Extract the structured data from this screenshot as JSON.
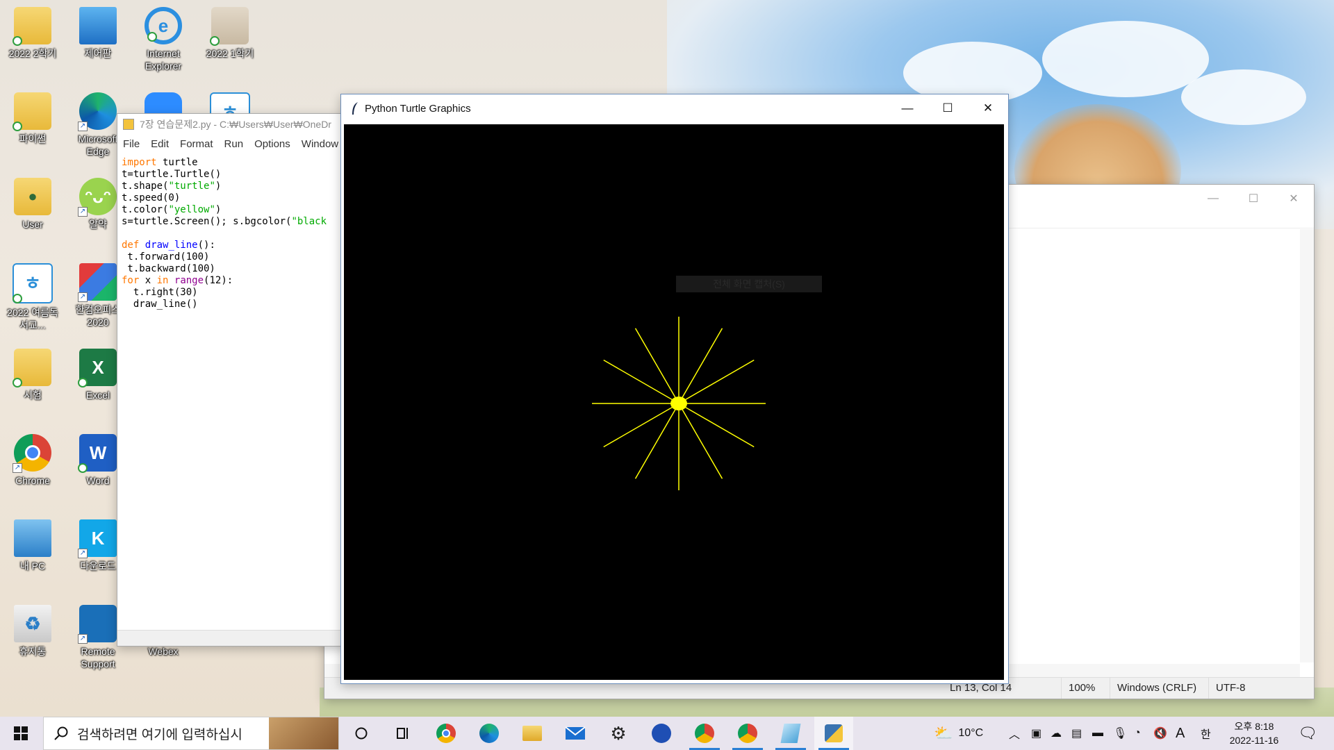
{
  "desktop": {
    "icons": [
      {
        "label": "2022 2학기"
      },
      {
        "label": "제어판"
      },
      {
        "label": "Internet Explorer"
      },
      {
        "label": "2022 1학기"
      },
      {
        "label": "파이썬"
      },
      {
        "label": "Microsoft Edge"
      },
      {
        "label": "User"
      },
      {
        "label": "알약"
      },
      {
        "label": "2022 여름독서교..."
      },
      {
        "label": "한컴오피스 2020"
      },
      {
        "label": "시험"
      },
      {
        "label": "Excel"
      },
      {
        "label": "Chrome"
      },
      {
        "label": "Word"
      },
      {
        "label": "내 PC"
      },
      {
        "label": "다운로드"
      },
      {
        "label": "휴지통"
      },
      {
        "label": "Remote Support"
      },
      {
        "label": "Webex"
      }
    ]
  },
  "idle": {
    "title": "7장 연습문제2.py - C:₩Users₩User₩OneDr",
    "menu": [
      "File",
      "Edit",
      "Format",
      "Run",
      "Options",
      "Window"
    ],
    "code": {
      "l1_kw": "import",
      "l1_rest": " turtle",
      "l2": "t=turtle.Turtle()",
      "l3_a": "t.shape(",
      "l3_s": "\"turtle\"",
      "l3_b": ")",
      "l4": "t.speed(0)",
      "l5_a": "t.color(",
      "l5_s": "\"yellow\"",
      "l5_b": ")",
      "l6_a": "s=turtle.Screen(); s.bgcolor(",
      "l6_s": "\"black",
      "l8_kw": "def",
      "l8_fn": " draw_line",
      "l8_b": "():",
      "l9": " t.forward(100)",
      "l10": " t.backward(100)",
      "l11_kw": "for",
      "l11_a": " x ",
      "l11_in": "in",
      "l11_sp": " ",
      "l11_bi": "range",
      "l11_b": "(12):",
      "l12": "  t.right(30)",
      "l13": "  draw_line()"
    }
  },
  "turtle": {
    "title": "Python Turtle Graphics",
    "tooltip": "전체 화면 캡처(S)",
    "drawing": {
      "color": "#ffff00",
      "rays": 12,
      "angle_step": 30,
      "length": 100
    }
  },
  "notepad": {
    "status": {
      "position": "Ln 13, Col 14",
      "zoom": "100%",
      "eol": "Windows (CRLF)",
      "encoding": "UTF-8"
    }
  },
  "taskbar": {
    "search_placeholder": "검색하려면 여기에 입력하십시",
    "weather": "10°C",
    "ime": "한",
    "font_indicator": "A",
    "time": "오후 8:18",
    "date": "2022-11-16",
    "accent": "#2a7fd4"
  }
}
